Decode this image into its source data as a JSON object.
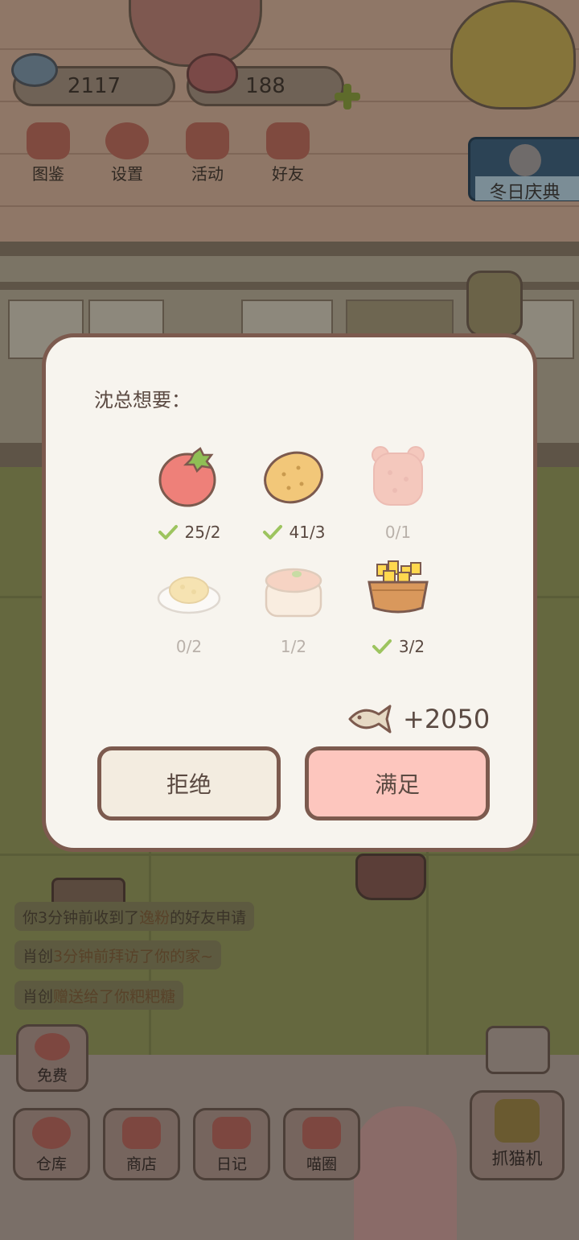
{
  "hud": {
    "fish_coins": "2117",
    "hearts": "188",
    "buttons": [
      {
        "label": "图鉴",
        "icon": "cat-book-icon"
      },
      {
        "label": "设置",
        "icon": "gear-icon"
      },
      {
        "label": "活动",
        "icon": "gift-icon"
      },
      {
        "label": "好友",
        "icon": "friends-icon"
      }
    ],
    "event_banner": "冬日庆典"
  },
  "dialog": {
    "title": "沈总想要：",
    "items": [
      {
        "name": "tomato",
        "count": "25/2",
        "fulfilled": true
      },
      {
        "name": "potato",
        "count": "41/3",
        "fulfilled": true
      },
      {
        "name": "gummy-bear",
        "count": "0/1",
        "fulfilled": false
      },
      {
        "name": "fried-rice",
        "count": "0/2",
        "fulfilled": false
      },
      {
        "name": "cake",
        "count": "1/2",
        "fulfilled": false
      },
      {
        "name": "fries-basket",
        "count": "3/2",
        "fulfilled": true
      }
    ],
    "reward": "+2050",
    "refuse_label": "拒绝",
    "accept_label": "满足"
  },
  "feed": [
    {
      "pre": "你3分钟前收到了",
      "hl": "逸粉",
      "post": "的好友申请"
    },
    {
      "pre": "肖创",
      "hl": "3分钟前拜访了你的家~",
      "post": ""
    },
    {
      "pre": "肖创",
      "hl": "赠送给了你粑粑糖",
      "post": ""
    }
  ],
  "bottom_nav": {
    "free_label": "免费",
    "items": [
      {
        "label": "仓库",
        "icon": "storage-icon"
      },
      {
        "label": "商店",
        "icon": "shop-icon"
      },
      {
        "label": "日记",
        "icon": "diary-icon"
      },
      {
        "label": "喵圈",
        "icon": "cat-circle-icon"
      }
    ],
    "claw_label": "抓猫机"
  },
  "colors": {
    "dialog_bg": "#f7f4ee",
    "dialog_border": "#7c5a4e",
    "accept_bg": "#fdc6be",
    "refuse_bg": "#f3ece0",
    "check_green": "#9dc45f"
  }
}
